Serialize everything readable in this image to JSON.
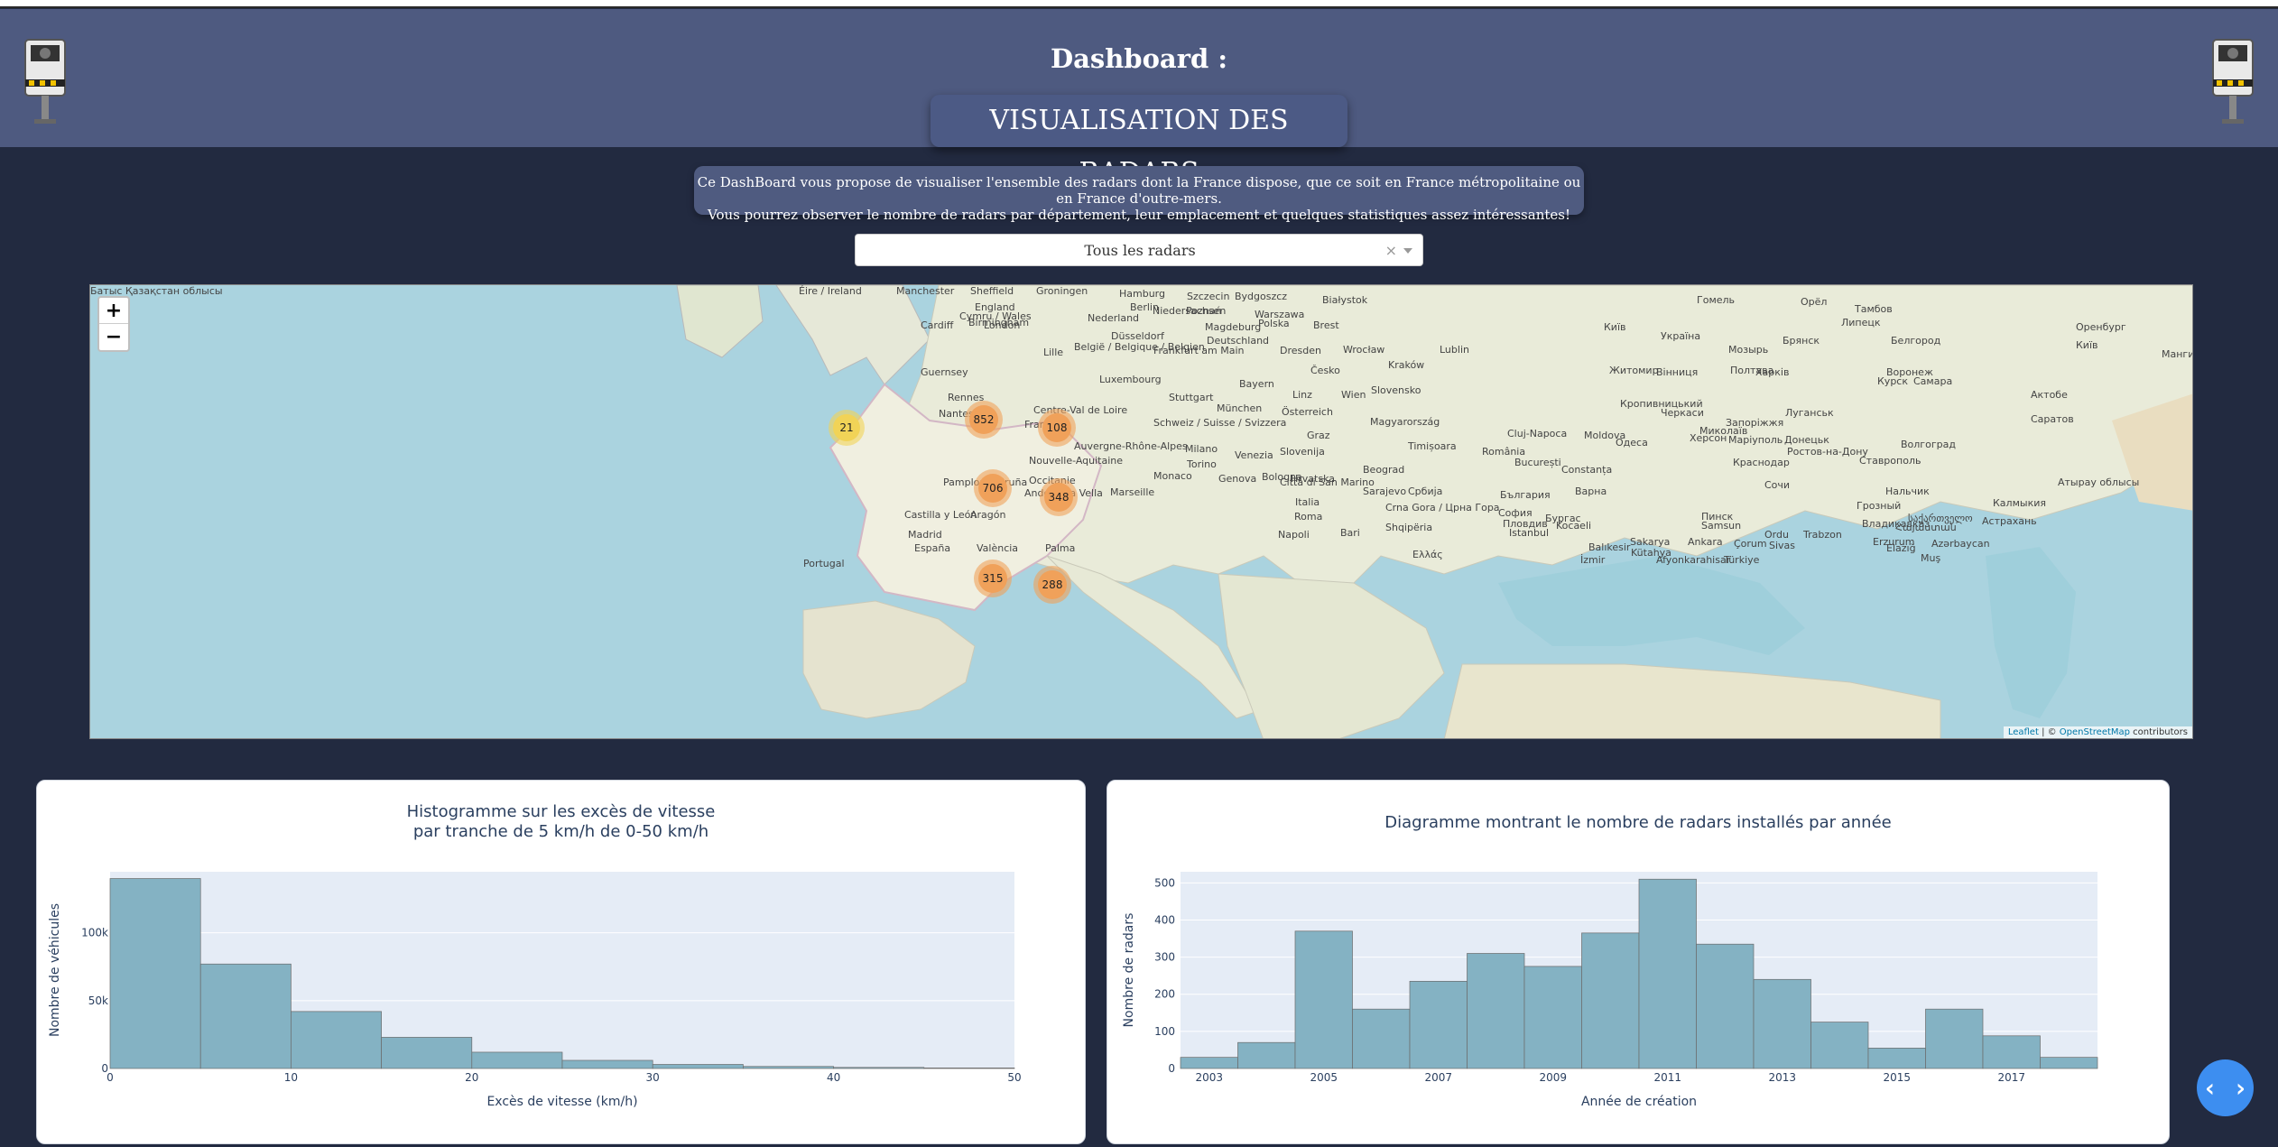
{
  "header": {
    "title": "Dashboard :",
    "subtitle": "VISUALISATION DES RADARS"
  },
  "description": {
    "line1": "Ce DashBoard vous propose de visualiser l'ensemble des radars dont la France dispose, que ce soit en France métropolitaine ou en France d'outre-mers.",
    "line2": "Vous pourrez observer le nombre de radars par département, leur emplacement et quelques statistiques assez intéressantes!"
  },
  "dropdown": {
    "selected": "Tous les radars",
    "clear_icon": "×"
  },
  "map": {
    "zoom_in": "+",
    "zoom_out": "−",
    "attribution_leaflet": "Leaflet",
    "attribution_sep": " | © ",
    "attribution_osm": "OpenStreetMap",
    "attribution_tail": " contributors",
    "clusters": [
      {
        "label": "21",
        "size": "small",
        "color": "#f1d357"
      },
      {
        "label": "852",
        "size": "medium",
        "color": "#f0a15a"
      },
      {
        "label": "108",
        "size": "medium",
        "color": "#f0a15a"
      },
      {
        "label": "706",
        "size": "medium",
        "color": "#f0a15a"
      },
      {
        "label": "348",
        "size": "medium",
        "color": "#f0a15a"
      },
      {
        "label": "315",
        "size": "medium",
        "color": "#f0a15a"
      },
      {
        "label": "288",
        "size": "medium",
        "color": "#f0a15a"
      }
    ],
    "place_labels": [
      "Éire / Ireland",
      "Manchester",
      "Sheffield",
      "England",
      "Birmingham",
      "Cymru / Wales",
      "Cardiff",
      "London",
      "Groningen",
      "Hamburg",
      "Szczecin",
      "Bydgoszcz",
      "Białystok",
      "Nederland",
      "Niedersachsen",
      "Berlin",
      "Poznań",
      "Warszawa",
      "Polska",
      "Düsseldorf",
      "Magdeburg",
      "Brest",
      "Deutschland",
      "Lille",
      "België / Belgique / Belgien",
      "Frankfurt am Main",
      "Dresden",
      "Wrocław",
      "Kraków",
      "Lublin",
      "Guernsey",
      "Luxembourg",
      "Bayern",
      "Česko",
      "Rennes",
      "Stuttgart",
      "Linz",
      "Wien",
      "Slovensko",
      "Nantes",
      "Centre-Val de Loire",
      "München",
      "Österreich",
      "France",
      "Schweiz / Suisse / Svizzera",
      "Graz",
      "Magyarország",
      "Milano",
      "Slovenija",
      "Auvergne-Rhône-Alpes",
      "Nouvelle-Aquitaine",
      "Torino",
      "Venezia",
      "Hrvatska",
      "Beograd",
      "Genova",
      "Bologna",
      "Occitanie",
      "Monaco",
      "Marseille",
      "Pamplona / Iruña",
      "Andorra la Vella",
      "Città di San Marino",
      "Sarajevo",
      "Србија",
      "Crna Gora / Црна Гора",
      "Castilla y León",
      "Aragón",
      "Roma",
      "Italia",
      "Madrid",
      "España",
      "València",
      "Palma",
      "Napoli",
      "Bari",
      "Portugal",
      "Shqipëria",
      "Ελλάς",
      "Cluj-Napoca",
      "Timișoara",
      "România",
      "București",
      "Constanța",
      "Варна",
      "България",
      "София",
      "Пловдив",
      "Бургас",
      "Istanbul",
      "Moldova",
      "Одеса",
      "Київ",
      "Україна",
      "Житомир",
      "Вінниця",
      "Черкаси",
      "Кропивницький",
      "Миколаїв",
      "Херсон",
      "Запоріжжя",
      "Маріуполь",
      "Донецьк",
      "Луганськ",
      "Харків",
      "Полтава",
      "Ростов-на-Дону",
      "Краснодар",
      "Ставрополь",
      "Сочи",
      "Нальчик",
      "Грозный",
      "Владикавказ",
      "საქართველო",
      "Samsun",
      "Ordu",
      "Trabzon",
      "Sakarya",
      "Ankara",
      "Çorum",
      "Sivas",
      "Türkiye",
      "Erzurum",
      "Elazığ",
      "Muş",
      "İzmir",
      "Balıkesir",
      "Kütahya",
      "Afyonkarahisar",
      "Kocaeli",
      "Azərbaycan",
      "Հայաստան",
      "Астрахань",
      "Калмыкия",
      "Волгоград",
      "Воронеж",
      "Орёл",
      "Липецк",
      "Тамбов",
      "Белгород",
      "Курск",
      "Брянск",
      "Гомель",
      "Мозырь",
      "Пинск",
      "Київ",
      "Оренбург",
      "Самара",
      "Саратов",
      "Атырау облысы",
      "Мангистау облысы",
      "Актобе",
      "Батыс Қазақстан облысы"
    ]
  },
  "histogram": {
    "title_line1": "Histogramme sur les excès de vitesse",
    "title_line2": "par tranche de 5 km/h de 0-50 km/h",
    "chart_data": {
      "type": "bar",
      "title": "Histogramme sur les excès de vitesse par tranche de 5 km/h de 0-50 km/h",
      "xlabel": "Excès de vitesse (km/h)",
      "ylabel": "Nombre de véhicules",
      "bin_edges": [
        0,
        5,
        10,
        15,
        20,
        25,
        30,
        35,
        40,
        45,
        50
      ],
      "values": [
        140000,
        77000,
        42000,
        23000,
        12000,
        6000,
        3000,
        1500,
        800,
        400
      ],
      "xlim": [
        0,
        50
      ],
      "ylim": [
        0,
        145000
      ],
      "x_ticks": [
        "0",
        "10",
        "20",
        "30",
        "40",
        "50"
      ],
      "y_ticks": [
        "0",
        "50k",
        "100k"
      ],
      "y_tick_values": [
        0,
        50000,
        100000
      ],
      "x_tick_values": [
        0,
        10,
        20,
        30,
        40,
        50
      ],
      "bar_color": "#84b2c3",
      "plot_bg": "#e5ecf6"
    }
  },
  "yearchart": {
    "title": "Diagramme montrant le nombre de radars installés par année",
    "chart_data": {
      "type": "bar",
      "title": "Diagramme montrant le nombre de radars installés par année",
      "xlabel": "Année de création",
      "ylabel": "Nombre de radars",
      "categories": [
        "2003",
        "2004",
        "2005",
        "2006",
        "2007",
        "2008",
        "2009",
        "2010",
        "2011",
        "2012",
        "2013",
        "2014",
        "2015",
        "2016",
        "2017",
        "2018"
      ],
      "values": [
        30,
        70,
        370,
        160,
        235,
        310,
        275,
        365,
        510,
        335,
        240,
        125,
        55,
        160,
        88,
        30
      ],
      "ylim": [
        0,
        530
      ],
      "x_ticks": [
        "2003",
        "2005",
        "2007",
        "2009",
        "2011",
        "2013",
        "2015",
        "2017"
      ],
      "y_ticks": [
        "0",
        "100",
        "200",
        "300",
        "400",
        "500"
      ],
      "y_tick_values": [
        0,
        100,
        200,
        300,
        400,
        500
      ],
      "bar_color": "#84b2c3",
      "plot_bg": "#e5ecf6"
    }
  },
  "fab": {
    "label": "‹ ›",
    "icon": "code-brackets-icon",
    "color": "#3d8ef0"
  }
}
